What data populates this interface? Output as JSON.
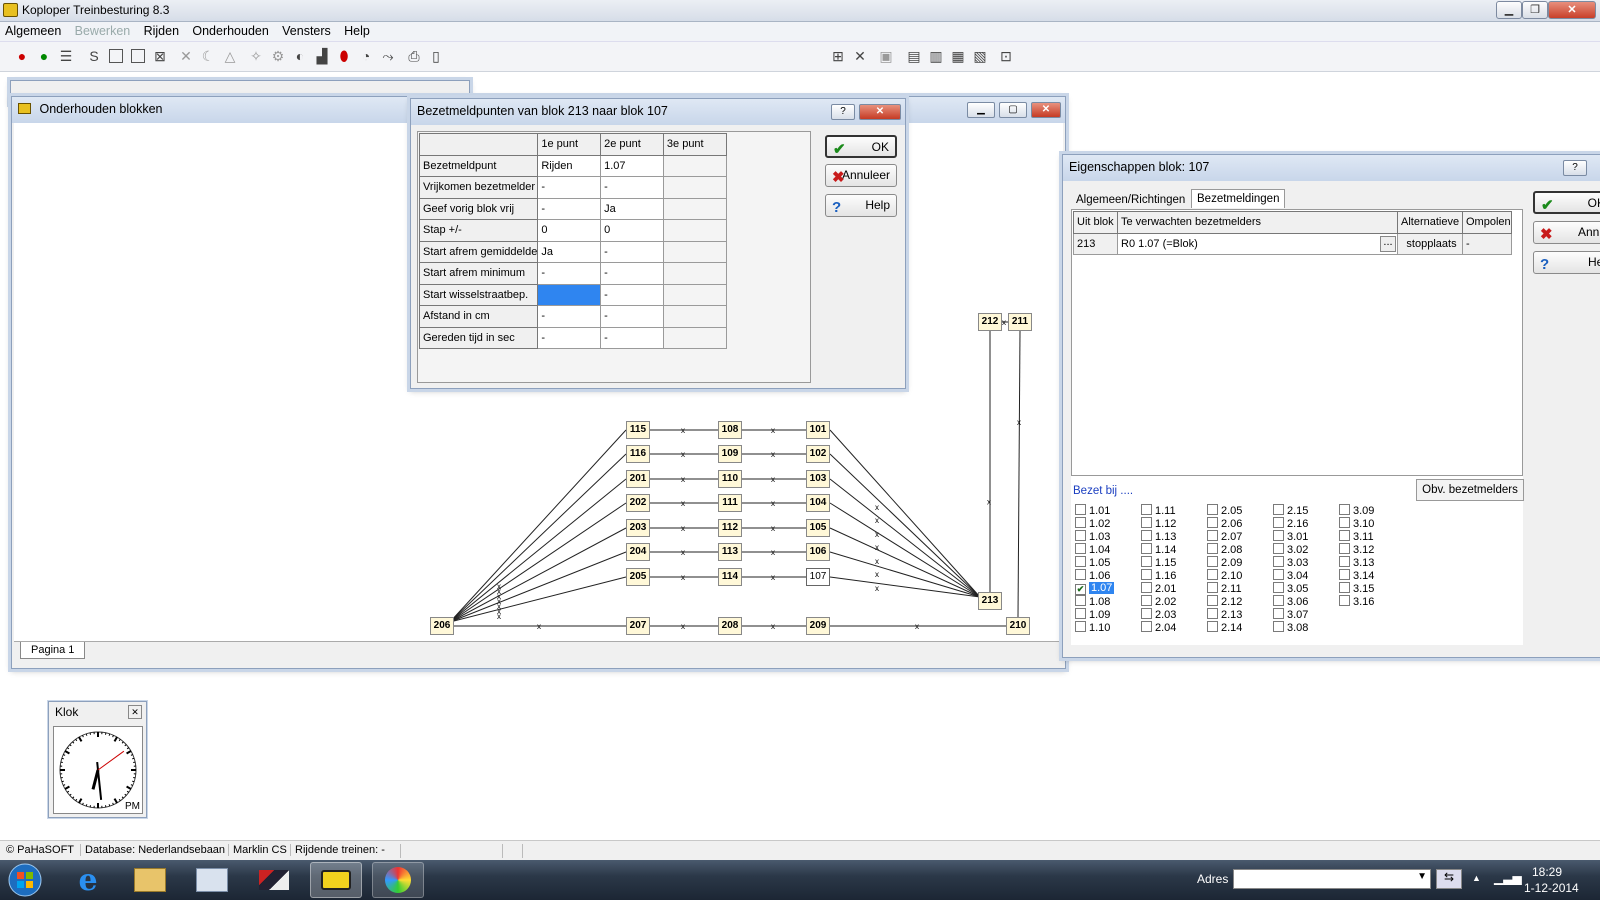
{
  "app": {
    "title": "Koploper Treinbesturing 8.3"
  },
  "menu": [
    {
      "label": "Algemeen",
      "disabled": false
    },
    {
      "label": "Bewerken",
      "disabled": true
    },
    {
      "label": "Rijden",
      "disabled": false
    },
    {
      "label": "Onderhouden",
      "disabled": false
    },
    {
      "label": "Vensters",
      "disabled": false
    },
    {
      "label": "Help",
      "disabled": false
    }
  ],
  "layout_window": {
    "title": "Onderhouden blokken",
    "page_tab": "Pagina 1",
    "blocks": [
      "115",
      "108",
      "101",
      "116",
      "109",
      "102",
      "201",
      "110",
      "103",
      "202",
      "111",
      "104",
      "203",
      "112",
      "105",
      "204",
      "113",
      "106",
      "205",
      "114",
      "107",
      "206",
      "207",
      "208",
      "209",
      "210",
      "212",
      "211",
      "213"
    ]
  },
  "points_dialog": {
    "title": "Bezetmeldpunten van blok 213 naar blok 107",
    "help_glyph": "?",
    "columns": [
      "1e punt",
      "2e punt",
      "3e punt"
    ],
    "rows": [
      {
        "label": "Bezetmeldpunt",
        "p1": "Rijden",
        "p2": "1.07",
        "p3": ""
      },
      {
        "label": "Vrijkomen bezetmelder",
        "p1": "-",
        "p2": "-",
        "p3": ""
      },
      {
        "label": "Geef vorig blok vrij",
        "p1": "-",
        "p2": "Ja",
        "p3": ""
      },
      {
        "label": "Stap +/-",
        "p1": "0",
        "p2": "0",
        "p3": ""
      },
      {
        "label": "Start afrem gemiddelde",
        "p1": "Ja",
        "p2": "-",
        "p3": ""
      },
      {
        "label": "Start afrem minimum",
        "p1": "-",
        "p2": "-",
        "p3": ""
      },
      {
        "label": "Start wisselstraatbep.",
        "p1": "",
        "p2": "-",
        "p3": ""
      },
      {
        "label": "Afstand in cm",
        "p1": "-",
        "p2": "-",
        "p3": ""
      },
      {
        "label": "Gereden tijd in sec",
        "p1": "-",
        "p2": "-",
        "p3": ""
      }
    ],
    "buttons": {
      "ok": "OK",
      "cancel": "Annuleer",
      "help": "Help"
    }
  },
  "props_dialog": {
    "title": "Eigenschappen blok: 107",
    "help_glyph": "?",
    "tabs": [
      "Algemeen/Richtingen",
      "Bezetmeldingen"
    ],
    "active_tab": "Bezetmeldingen",
    "table_headers": [
      "Uit blok",
      "Te verwachten bezetmelders",
      "Alternatieve",
      "Ompolen"
    ],
    "row": {
      "from_block": "213",
      "expected": "R0  1.07 (=Blok)",
      "ellipsis": "...",
      "alternative": "stopplaats",
      "reverse": "-"
    },
    "bezet_label": "Bezet bij ....",
    "obv_button": "Obv. bezetmelders",
    "side_buttons": {
      "ok": "OK",
      "cancel": "Annu",
      "help": "Hel"
    },
    "checkbox_columns": [
      [
        "1.01",
        "1.02",
        "1.03",
        "1.04",
        "1.05",
        "1.06",
        "1.07",
        "1.08",
        "1.09",
        "1.10"
      ],
      [
        "1.11",
        "1.12",
        "1.13",
        "1.14",
        "1.15",
        "1.16",
        "2.01",
        "2.02",
        "2.03",
        "2.04"
      ],
      [
        "2.05",
        "2.06",
        "2.07",
        "2.08",
        "2.09",
        "2.10",
        "2.11",
        "2.12",
        "2.13",
        "2.14"
      ],
      [
        "2.15",
        "2.16",
        "3.01",
        "3.02",
        "3.03",
        "3.04",
        "3.05",
        "3.06",
        "3.07",
        "3.08"
      ],
      [
        "3.09",
        "3.10",
        "3.11",
        "3.12",
        "3.13",
        "3.14",
        "3.15",
        "3.16"
      ]
    ],
    "checked": "1.07"
  },
  "clock": {
    "title": "Klok",
    "ampm": "PM",
    "hour": 18,
    "minute": 29
  },
  "status": {
    "copyright": "© PaHaSOFT",
    "database": "Database: Nederlandsebaan",
    "controller": "Marklin CS",
    "trains": "Rijdende treinen: -"
  },
  "taskbar": {
    "address_label": "Adres",
    "time": "18:29",
    "date": "1-12-2014"
  }
}
